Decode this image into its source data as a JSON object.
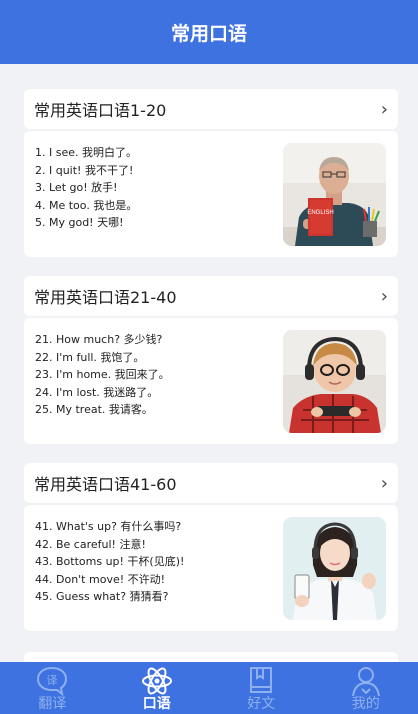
{
  "header": {
    "title": "常用口语"
  },
  "sections": [
    {
      "title": "常用英语口语1-20",
      "lines": [
        "1. I see. 我明白了。",
        "2. I quit! 我不干了!",
        "3. Let go! 放手!",
        "4. Me too. 我也是。",
        "5. My god! 天哪!"
      ],
      "photo": "man-holding-english-book"
    },
    {
      "title": "常用英语口语21-40",
      "lines": [
        "21. How much? 多少钱?",
        "22. I'm full. 我饱了。",
        "23. I'm home. 我回来了。",
        "24. I'm lost. 我迷路了。",
        "25. My treat. 我请客。"
      ],
      "photo": "boy-with-headphones-and-phone"
    },
    {
      "title": "常用英语口语41-60",
      "lines": [
        "41. What's up? 有什么事吗?",
        "42. Be careful! 注意!",
        "43. Bottoms up! 干杯(见底)!",
        "44. Don't move! 不许动!",
        "45. Guess what? 猜猜看?"
      ],
      "photo": "woman-with-headset-and-phone"
    }
  ],
  "tabs": [
    {
      "label": "翻译",
      "icon": "translate-bubble-icon",
      "active": false
    },
    {
      "label": "口语",
      "icon": "atom-icon",
      "active": true
    },
    {
      "label": "好文",
      "icon": "book-icon",
      "active": false
    },
    {
      "label": "我的",
      "icon": "person-icon",
      "active": false
    }
  ],
  "colors": {
    "primary": "#3e72e0",
    "background": "#f1f2f6",
    "tab_inactive": "#8fb0ee"
  }
}
